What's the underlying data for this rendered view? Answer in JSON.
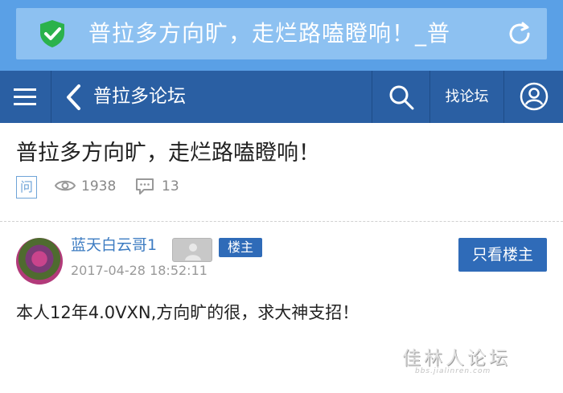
{
  "browser": {
    "url_text": "普拉多方向旷，走烂路嗑瞪响！_普",
    "shield_icon": "shield-check-icon",
    "reload_icon": "reload-icon"
  },
  "navbar": {
    "menu_icon": "menu-icon",
    "back_icon": "chevron-left-icon",
    "title": "普拉多论坛",
    "search_icon": "search-icon",
    "find_forum_label": "找论坛",
    "user_icon": "user-icon"
  },
  "thread": {
    "title": "普拉多方向旷，走烂路嗑瞪响！",
    "type_badge": "问",
    "views": "1938",
    "comments": "13"
  },
  "post": {
    "username": "蓝天白云哥1",
    "owner_tag": "楼主",
    "time": "2017-04-28 18:52:11",
    "only_owner_label": "只看楼主",
    "body": "本人12年4.0VXN,方向旷的很，求大神支招！"
  },
  "watermark": {
    "text": "佳林人论坛",
    "sub": "bbs.jialinren.com"
  },
  "colors": {
    "browser_bar": "#5aa0e6",
    "navbar": "#2a5fa3",
    "accent": "#2f6bb8",
    "shield": "#2bb24c"
  }
}
